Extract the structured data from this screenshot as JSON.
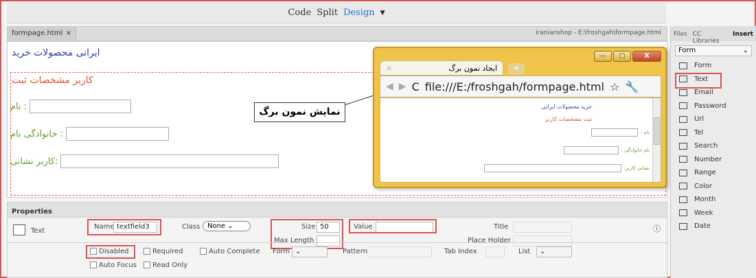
{
  "viewbar": {
    "code": "Code",
    "split": "Split",
    "design": "Design"
  },
  "doc_tab": {
    "name": "formpage.html",
    "close": "×"
  },
  "path": "iranianshop - E:\\froshgah\\formpage.html",
  "design": {
    "title": "ایرانی محصولات خرید",
    "legend": "کاربر مشخصات ثبت",
    "fields": [
      {
        "label": ": نام"
      },
      {
        "label": ": خانوادگی نام"
      },
      {
        "label": ":کاربر نشانی"
      }
    ]
  },
  "browser": {
    "tab_title": "ایجاد نمون برگ",
    "url": "file:///E:/froshgah/formpage.html",
    "content_title": "خرید محصولات ایرانی",
    "content_legend": "ثبت مشخصات کاربر",
    "mini_labels": [
      "نام :",
      "نام خانوادگی :",
      "نشانی کاربر:"
    ]
  },
  "callout": "نمایش نمون برگ",
  "properties": {
    "header": "Properties",
    "element_type": "Text",
    "name_label": "Name",
    "name_value": "textfield3",
    "class_label": "Class",
    "class_value": "None",
    "size_label": "Size",
    "size_value": "50",
    "maxlength_label": "Max Length",
    "value_label": "Value",
    "title_label": "Title",
    "placeholder_label": "Place Holder",
    "disabled": "Disabled",
    "required": "Required",
    "autocomplete": "Auto Complete",
    "autofocus": "Auto Focus",
    "readonly": "Read Only",
    "form_label": "Form",
    "pattern_label": "Pattern",
    "tabindex_label": "Tab Index",
    "list_label": "List"
  },
  "insert_panel": {
    "tabs": [
      "Files",
      "CC Libraries",
      "Insert"
    ],
    "category": "Form",
    "items": [
      "Form",
      "Text",
      "Email",
      "Password",
      "Url",
      "Tel",
      "Search",
      "Number",
      "Range",
      "Color",
      "Month",
      "Week",
      "Date"
    ],
    "icons": [
      "form-icon",
      "text-icon",
      "email-icon",
      "password-icon",
      "url-icon",
      "tel-icon",
      "search-icon",
      "number-icon",
      "range-icon",
      "color-icon",
      "month-icon",
      "week-icon",
      "date-icon"
    ]
  }
}
